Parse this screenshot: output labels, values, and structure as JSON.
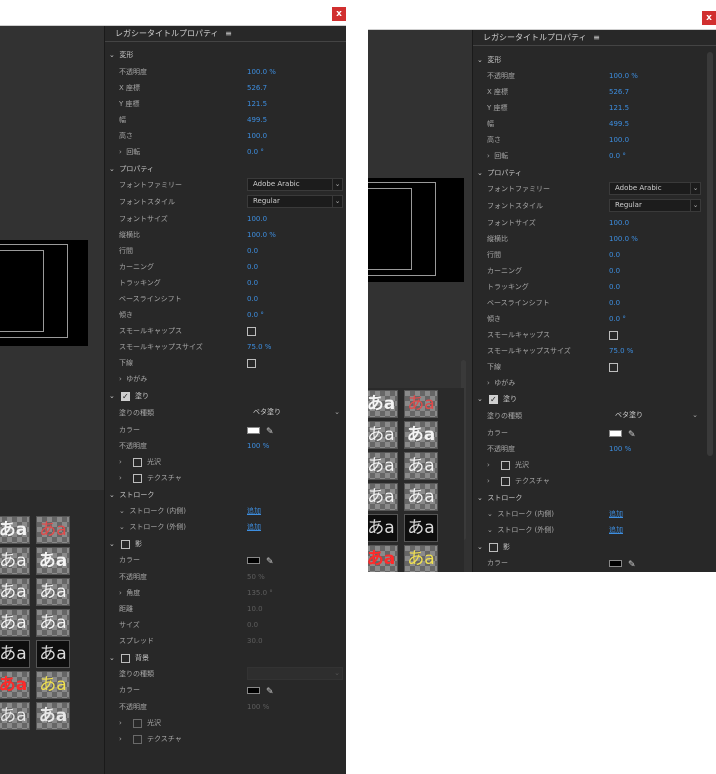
{
  "close_label": "x",
  "panel_title": "レガシータイトルプロパティ",
  "menu_icon": "≡",
  "sample_text": "あa",
  "sections": {
    "transform": "変形",
    "properties": "プロパティ",
    "fill": "塗り",
    "stroke": "ストローク",
    "shadow": "影",
    "background": "背景"
  },
  "labels": {
    "opacity": "不透明度",
    "x": "X 座標",
    "y": "Y 座標",
    "width": "幅",
    "height": "高さ",
    "rotation": "回転",
    "font_family": "フォントファミリー",
    "font_style": "フォントスタイル",
    "font_size": "フォントサイズ",
    "aspect": "縦横比",
    "leading": "行間",
    "kerning": "カーニング",
    "tracking": "トラッキング",
    "baseline": "ベースラインシフト",
    "slant": "傾き",
    "small_caps": "スモールキャップス",
    "small_caps_size": "スモールキャップスサイズ",
    "underline": "下線",
    "distort": "ゆがみ",
    "fill_type": "塗りの種類",
    "color": "カラー",
    "sheen": "光沢",
    "texture": "テクスチャ",
    "inner_stroke": "ストローク (内側)",
    "outer_stroke": "ストローク (外側)",
    "angle": "角度",
    "distance": "距離",
    "size": "サイズ",
    "spread": "スプレッド"
  },
  "values": {
    "opacity": "100.0 %",
    "x": "526.7",
    "y": "121.5",
    "width": "499.5",
    "height": "100.0",
    "rotation": "0.0 °",
    "font_family": "Adobe Arabic",
    "font_style": "Regular",
    "font_size": "100.0",
    "aspect": "100.0 %",
    "leading": "0.0",
    "kerning": "0.0",
    "tracking": "0.0",
    "baseline": "0.0",
    "slant": "0.0 °",
    "small_caps_size": "75.0 %",
    "fill_type": "ベタ塗り",
    "fill_opacity": "100 %",
    "add": "追加",
    "shadow_opacity": "50 %",
    "shadow_angle": "135.0 °",
    "shadow_distance": "10.0",
    "shadow_size": "0.0",
    "shadow_spread": "30.0",
    "bg_opacity": "100 %"
  },
  "colors": {
    "fill_color": "#ffffff",
    "shadow_color": "#000000",
    "bg_color": "#000000",
    "accent": "#3d8ee0"
  }
}
